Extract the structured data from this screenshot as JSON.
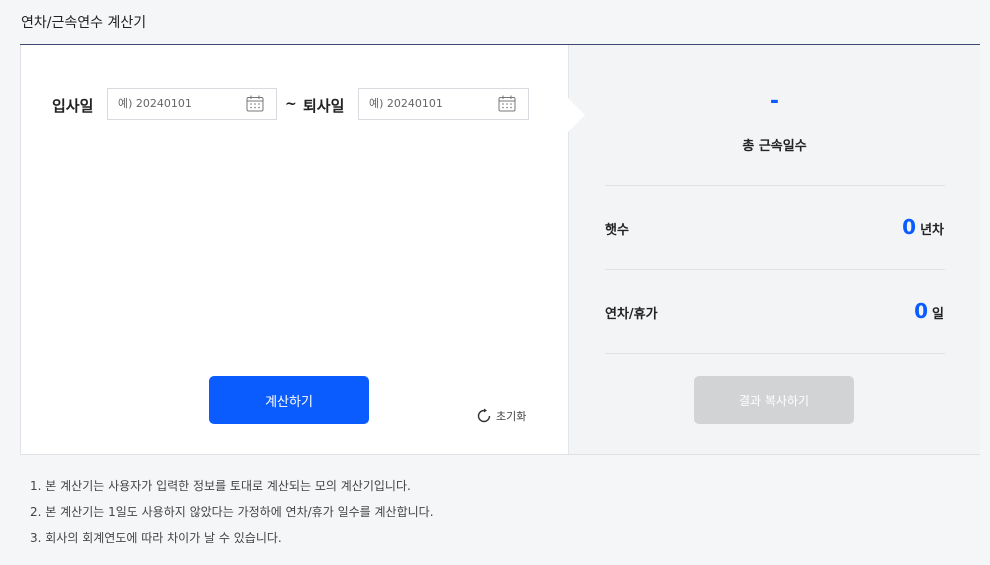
{
  "header": {
    "title": "연차/근속연수 계산기"
  },
  "form": {
    "start_label": "입사일",
    "start_placeholder": "예) 20240101",
    "separator": "~",
    "end_label": "퇴사일",
    "end_placeholder": "예) 20240101",
    "calculate_label": "계산하기",
    "reset_label": "초기화"
  },
  "result": {
    "total_value": "-",
    "total_label": "총 근속일수",
    "years_label": "햇수",
    "years_value": "0",
    "years_unit": "년차",
    "leave_label": "연차/휴가",
    "leave_value": "0",
    "leave_unit": "일",
    "copy_label": "결과 복사하기"
  },
  "notes": [
    "1. 본 계산기는 사용자가 입력한 정보를 토대로 계산되는 모의 계산기입니다.",
    "2. 본 계산기는 1일도 사용하지 않았다는 가정하에 연차/휴가 일수를 계산합니다.",
    "3. 회사의 회계연도에 따라 차이가 날 수 있습니다."
  ],
  "colors": {
    "accent": "#0b5cff",
    "disabled": "#d2d3d5",
    "rule": "#3b4a70"
  },
  "icons": {
    "date_picker": "calendar-icon",
    "reset": "refresh-icon"
  }
}
